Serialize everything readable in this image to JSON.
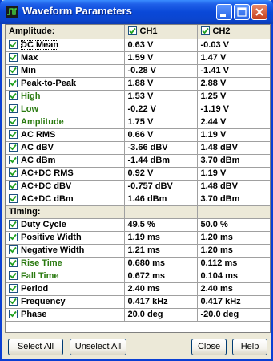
{
  "window": {
    "title": "Waveform Parameters"
  },
  "columns": {
    "label": "Amplitude:",
    "ch1": "CH1",
    "ch2": "CH2"
  },
  "amplitude_rows": [
    {
      "label": "DC  Mean",
      "ch1": "0.63 V",
      "ch2": "-0.03 V",
      "green": false,
      "focused": true
    },
    {
      "label": "Max",
      "ch1": "1.59 V",
      "ch2": "1.47 V",
      "green": false
    },
    {
      "label": "Min",
      "ch1": "-0.28 V",
      "ch2": "-1.41 V",
      "green": false
    },
    {
      "label": "Peak-to-Peak",
      "ch1": "1.88 V",
      "ch2": "2.88 V",
      "green": false
    },
    {
      "label": "High",
      "ch1": "1.53 V",
      "ch2": "1.25 V",
      "green": true
    },
    {
      "label": "Low",
      "ch1": "-0.22 V",
      "ch2": "-1.19 V",
      "green": true
    },
    {
      "label": "Amplitude",
      "ch1": "1.75 V",
      "ch2": "2.44 V",
      "green": true
    },
    {
      "label": "AC RMS",
      "ch1": "0.66 V",
      "ch2": "1.19 V",
      "green": false
    },
    {
      "label": "AC dBV",
      "ch1": "-3.66 dBV",
      "ch2": "1.48 dBV",
      "green": false
    },
    {
      "label": "AC dBm",
      "ch1": "-1.44 dBm",
      "ch2": "3.70 dBm",
      "green": false
    },
    {
      "label": "AC+DC RMS",
      "ch1": "0.92 V",
      "ch2": "1.19 V",
      "green": false
    },
    {
      "label": "AC+DC dBV",
      "ch1": "-0.757 dBV",
      "ch2": "1.48 dBV",
      "green": false
    },
    {
      "label": "AC+DC dBm",
      "ch1": "1.46 dBm",
      "ch2": "3.70 dBm",
      "green": false
    }
  ],
  "timing_label": "Timing:",
  "timing_rows": [
    {
      "label": "Duty Cycle",
      "ch1": "49.5 %",
      "ch2": "50.0 %",
      "green": false
    },
    {
      "label": "Positive Width",
      "ch1": "1.19 ms",
      "ch2": "1.20 ms",
      "green": false
    },
    {
      "label": "Negative Width",
      "ch1": "1.21 ms",
      "ch2": "1.20 ms",
      "green": false
    },
    {
      "label": "Rise Time",
      "ch1": "0.680 ms",
      "ch2": "0.112 ms",
      "green": true
    },
    {
      "label": "Fall Time",
      "ch1": "0.672 ms",
      "ch2": "0.104 ms",
      "green": true
    },
    {
      "label": "Period",
      "ch1": "2.40 ms",
      "ch2": "2.40 ms",
      "green": false
    },
    {
      "label": "Frequency",
      "ch1": "0.417 kHz",
      "ch2": "0.417 kHz",
      "green": false
    },
    {
      "label": "Phase",
      "ch1": "20.0 deg",
      "ch2": "-20.0 deg",
      "green": false
    }
  ],
  "buttons": {
    "select_all": "Select All",
    "unselect_all": "Unselect All",
    "close": "Close",
    "help": "Help"
  },
  "colors": {
    "title_bar": "#0a48d8",
    "green_label": "#2a7a10",
    "checkmark": "#21a121",
    "dialog_bg": "#ece9d8"
  },
  "icons": {
    "app": "waveform-icon",
    "minimize": "minimize-icon",
    "maximize": "maximize-icon",
    "close": "close-icon",
    "check": "checkmark-icon"
  }
}
